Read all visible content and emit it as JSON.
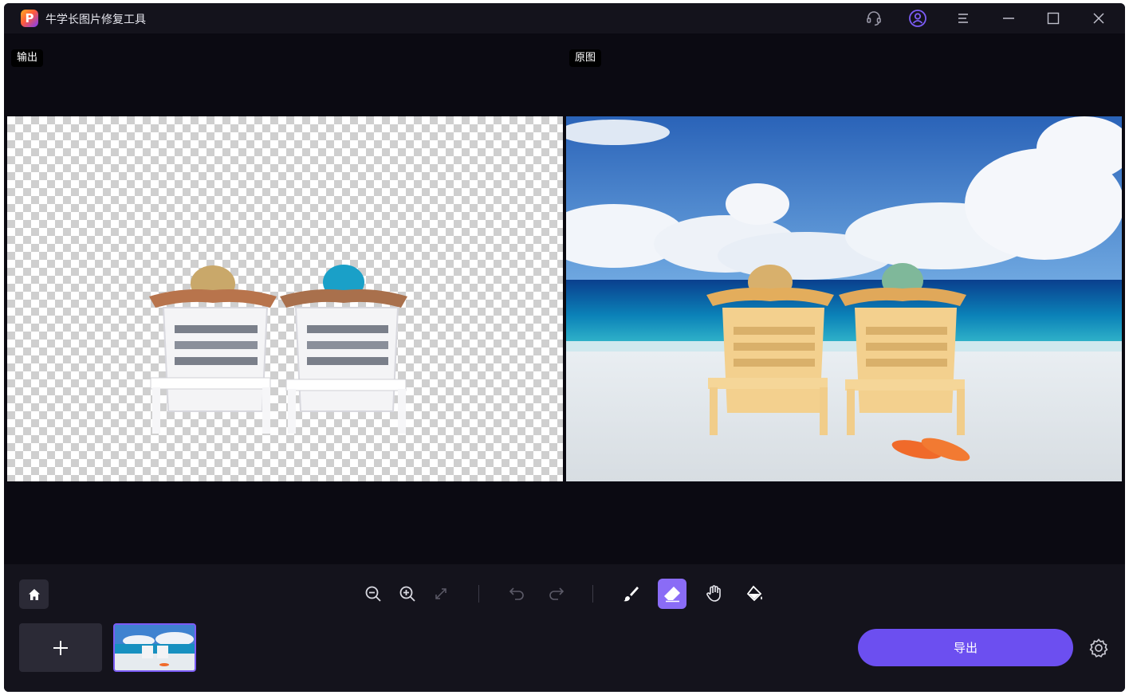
{
  "app": {
    "title": "牛学长图片修复工具",
    "logo_letter": "P",
    "accent": "#6c4ff0"
  },
  "titlebar": {
    "icons": [
      "headset-icon",
      "account-icon",
      "menu-icon",
      "minimize-icon",
      "maximize-icon",
      "close-icon"
    ]
  },
  "panes": {
    "output_label": "输出",
    "original_label": "原图"
  },
  "toolbar": {
    "tools": [
      "home-icon",
      "zoom-out-icon",
      "zoom-in-icon",
      "fit-screen-icon",
      "undo-icon",
      "redo-icon",
      "brush-icon",
      "eraser-icon",
      "hand-icon",
      "fill-icon"
    ],
    "active_tool": "eraser-icon",
    "add_label": "+",
    "export_label": "导出"
  },
  "colors": {
    "window_bg": "#0b0a12",
    "panel_bg": "#14131c",
    "button_bg": "#2b2a36",
    "active_tool": "#8a6cf6",
    "export": "#6c4ff0"
  }
}
